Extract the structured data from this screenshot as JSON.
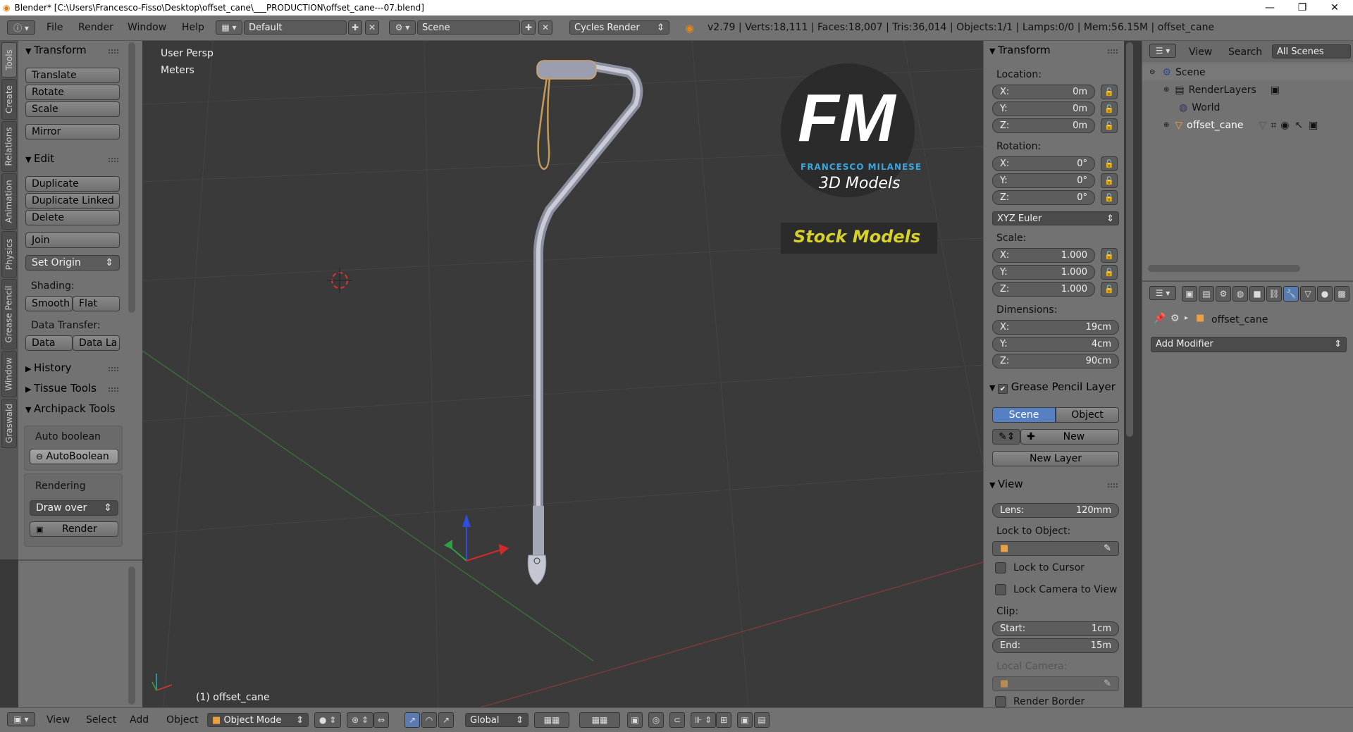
{
  "titlebar": {
    "title": "Blender* [C:\\Users\\Francesco-Fisso\\Desktop\\offset_cane\\___PRODUCTION\\offset_cane---07.blend]",
    "minimize": "—",
    "maximize": "❐",
    "close": "✕"
  },
  "menubar": {
    "info_icon": "info-icon",
    "menus": [
      "File",
      "Render",
      "Window",
      "Help"
    ],
    "layout": "Default",
    "scene": "Scene",
    "engine": "Cycles Render",
    "stats": "v2.79 | Verts:18,111 | Faces:18,007 | Tris:36,014 | Objects:1/1 | Lamps:0/0 | Mem:56.15M | offset_cane"
  },
  "lefttabs": [
    "Tools",
    "Create",
    "Relations",
    "Animation",
    "Physics",
    "Grease Pencil",
    "Window",
    "Graswald"
  ],
  "toolshelf": {
    "transform": {
      "header": "Transform",
      "translate": "Translate",
      "rotate": "Rotate",
      "scale": "Scale",
      "mirror": "Mirror"
    },
    "edit": {
      "header": "Edit",
      "duplicate": "Duplicate",
      "duplicate_linked": "Duplicate Linked",
      "delete": "Delete",
      "join": "Join",
      "set_origin": "Set Origin",
      "shading_label": "Shading:",
      "smooth": "Smooth",
      "flat": "Flat",
      "data_transfer_label": "Data Transfer:",
      "data": "Data",
      "data_la": "Data La"
    },
    "history": "History",
    "tissue_tools": "Tissue Tools",
    "archipack": {
      "header": "Archipack Tools",
      "auto_boolean_label": "Auto boolean",
      "autoboolean_button": "AutoBoolean",
      "rendering_label": "Rendering",
      "draw_over": "Draw over",
      "render_button": "Render"
    }
  },
  "viewport": {
    "view_name": "User Persp",
    "units": "Meters",
    "object_label": "(1) offset_cane",
    "watermark": {
      "initials": "FM",
      "brand": "FRANCESCO MILANESE",
      "sub": "3D Models",
      "banner": "Stock Models"
    }
  },
  "npanel": {
    "transform_header": "Transform",
    "location_label": "Location:",
    "location": {
      "x": "0m",
      "y": "0m",
      "z": "0m"
    },
    "rotation_label": "Rotation:",
    "rotation": {
      "x": "0°",
      "y": "0°",
      "z": "0°"
    },
    "rotation_mode": "XYZ Euler",
    "scale_label": "Scale:",
    "scale": {
      "x": "1.000",
      "y": "1.000",
      "z": "1.000"
    },
    "dimensions_label": "Dimensions:",
    "dimensions": {
      "x": "19cm",
      "y": "4cm",
      "z": "90cm"
    },
    "axis": {
      "x": "X:",
      "y": "Y:",
      "z": "Z:"
    },
    "grease_header": "Grease Pencil Layer",
    "scene_tab": "Scene",
    "object_tab": "Object",
    "new": "New",
    "new_layer": "New Layer",
    "view_header": "View",
    "lens_label": "Lens:",
    "lens": "120mm",
    "lock_object_label": "Lock to Object:",
    "lock_cursor": "Lock to Cursor",
    "lock_camera": "Lock Camera to View",
    "clip_label": "Clip:",
    "clip_start_label": "Start:",
    "clip_start": "1cm",
    "clip_end_label": "End:",
    "clip_end": "15m",
    "local_camera_label": "Local Camera:",
    "render_border": "Render Border"
  },
  "outliner": {
    "view": "View",
    "search": "Search",
    "filter": "All Scenes",
    "items": [
      "Scene",
      "RenderLayers",
      "World",
      "offset_cane"
    ]
  },
  "properties": {
    "object_name": "offset_cane",
    "add_modifier": "Add Modifier"
  },
  "bottombar": {
    "menus": [
      "View",
      "Select",
      "Add",
      "Object"
    ],
    "mode": "Object Mode",
    "orientation": "Global"
  },
  "colors": {
    "panel": "#727272",
    "viewport": "#3a3a3a",
    "accent": "#5680c2",
    "watermark_blue": "#3aa6dd",
    "watermark_yellow": "#d7d227"
  }
}
